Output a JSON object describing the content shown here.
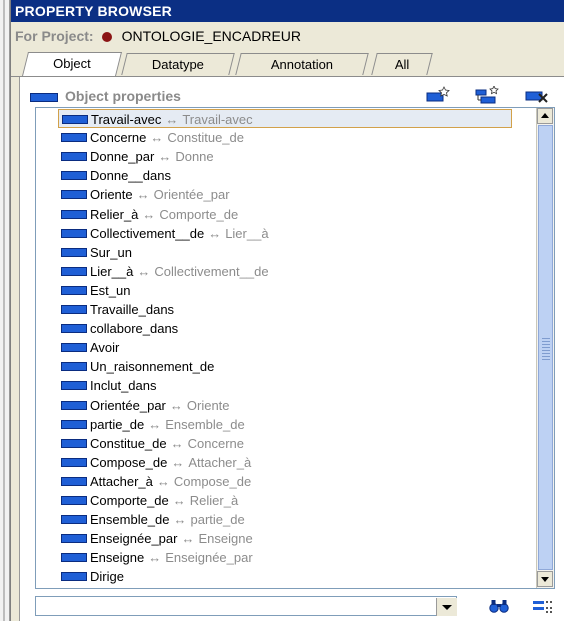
{
  "header": {
    "title": "PROPERTY BROWSER"
  },
  "project": {
    "label": "For Project:",
    "name": "ONTOLOGIE_ENCADREUR"
  },
  "tabs": [
    {
      "label": "Object",
      "active": true
    },
    {
      "label": "Datatype",
      "active": false
    },
    {
      "label": "Annotation",
      "active": false
    },
    {
      "label": "All",
      "active": false
    }
  ],
  "section": {
    "title": "Object properties"
  },
  "toolbar_icons": [
    "create-property-icon",
    "create-subproperty-icon",
    "delete-property-icon"
  ],
  "properties": [
    {
      "name": "Travail-avec",
      "inverse": "Travail-avec",
      "selected": true
    },
    {
      "name": "Concerne",
      "inverse": "Constitue_de"
    },
    {
      "name": "Donne_par",
      "inverse": "Donne"
    },
    {
      "name": "Donne__dans",
      "inverse": ""
    },
    {
      "name": "Oriente",
      "inverse": "Orientée_par"
    },
    {
      "name": "Relier_à",
      "inverse": "Comporte_de"
    },
    {
      "name": "Collectivement__de",
      "inverse": "Lier__à"
    },
    {
      "name": "Sur_un",
      "inverse": ""
    },
    {
      "name": "Lier__à",
      "inverse": "Collectivement__de"
    },
    {
      "name": "Est_un",
      "inverse": ""
    },
    {
      "name": "Travaille_dans",
      "inverse": ""
    },
    {
      "name": "collabore_dans",
      "inverse": ""
    },
    {
      "name": "Avoir",
      "inverse": ""
    },
    {
      "name": "Un_raisonnement_de",
      "inverse": ""
    },
    {
      "name": "Inclut_dans",
      "inverse": ""
    },
    {
      "name": "Orientée_par",
      "inverse": "Oriente"
    },
    {
      "name": "partie_de",
      "inverse": "Ensemble_de"
    },
    {
      "name": "Constitue_de",
      "inverse": "Concerne"
    },
    {
      "name": "Compose_de",
      "inverse": "Attacher_à"
    },
    {
      "name": "Attacher_à",
      "inverse": "Compose_de"
    },
    {
      "name": "Comporte_de",
      "inverse": "Relier_à"
    },
    {
      "name": "Ensemble_de",
      "inverse": "partie_de"
    },
    {
      "name": "Enseignée_par",
      "inverse": "Enseigne"
    },
    {
      "name": "Enseigne",
      "inverse": "Enseignée_par"
    },
    {
      "name": "Dirige",
      "inverse": ""
    }
  ],
  "inverse_arrow": "↔",
  "search": {
    "value": ""
  },
  "colors": {
    "title_bg": "#0b2f84",
    "property_icon": "#1f5fd6",
    "selection_border": "#d2a14a"
  }
}
